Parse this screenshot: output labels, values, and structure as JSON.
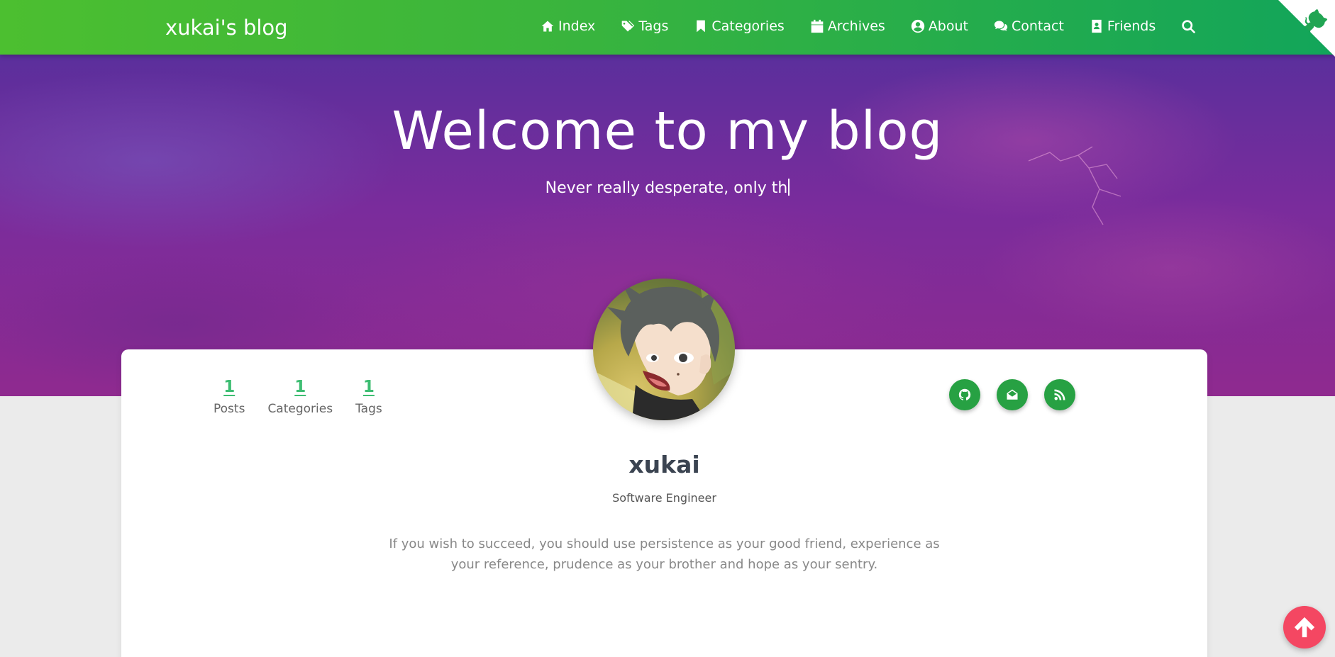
{
  "navbar": {
    "brand": "xukai's blog",
    "items": [
      {
        "label": "Index",
        "icon": "home-icon"
      },
      {
        "label": "Tags",
        "icon": "tags-icon"
      },
      {
        "label": "Categories",
        "icon": "bookmark-icon"
      },
      {
        "label": "Archives",
        "icon": "calendar-icon"
      },
      {
        "label": "About",
        "icon": "user-circle-icon"
      },
      {
        "label": "Contact",
        "icon": "comments-icon"
      },
      {
        "label": "Friends",
        "icon": "address-book-icon"
      }
    ],
    "search_icon": "search-icon",
    "github_corner_icon": "github-octocat-icon"
  },
  "banner": {
    "title": "Welcome to my blog",
    "subtitle": "Never really desperate, only th"
  },
  "profile": {
    "stats": [
      {
        "value": "1",
        "label": "Posts"
      },
      {
        "value": "1",
        "label": "Categories"
      },
      {
        "value": "1",
        "label": "Tags"
      }
    ],
    "name": "xukai",
    "title": "Software Engineer",
    "motto": "If you wish to succeed, you should use persistence as your good friend, experience as your reference, prudence as your brother and hope as your sentry.",
    "socials": [
      "github-icon",
      "email-icon",
      "rss-icon"
    ]
  },
  "colors": {
    "navbar_start": "#4cbf30",
    "navbar_end": "#12a55a",
    "accent_green": "#3dbd72",
    "social_green": "#27a143",
    "back_to_top": "#f44762"
  },
  "back_to_top_icon": "arrow-up-icon"
}
